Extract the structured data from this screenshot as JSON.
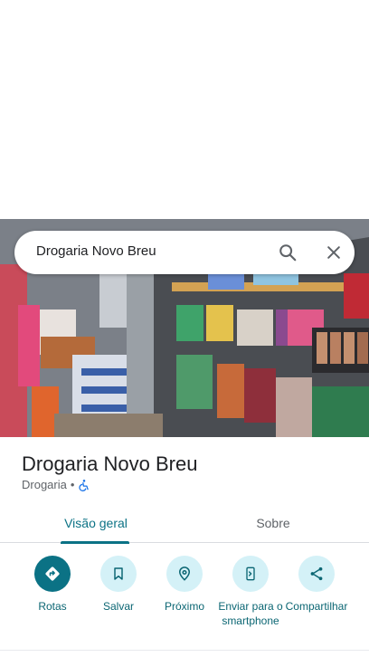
{
  "search": {
    "query": "Drogaria Novo Breu"
  },
  "place": {
    "name": "Drogaria Novo Breu",
    "category": "Drogaria",
    "separator": "•",
    "accessibility_icon": "wheelchair-icon"
  },
  "tabs": [
    {
      "label": "Visão geral",
      "selected": true
    },
    {
      "label": "Sobre",
      "selected": false
    }
  ],
  "actions": [
    {
      "label": "Rotas",
      "icon": "directions-icon"
    },
    {
      "label": "Salvar",
      "icon": "bookmark-icon"
    },
    {
      "label": "Próximo",
      "icon": "nearby-icon"
    },
    {
      "label": "Enviar para o smartphone",
      "icon": "send-to-phone-icon"
    },
    {
      "label": "Compartilhar",
      "icon": "share-icon"
    }
  ],
  "colors": {
    "accent": "#0b7285",
    "action_bg": "#d4f1f7",
    "text": "#202124",
    "secondary_text": "#5f6368"
  }
}
